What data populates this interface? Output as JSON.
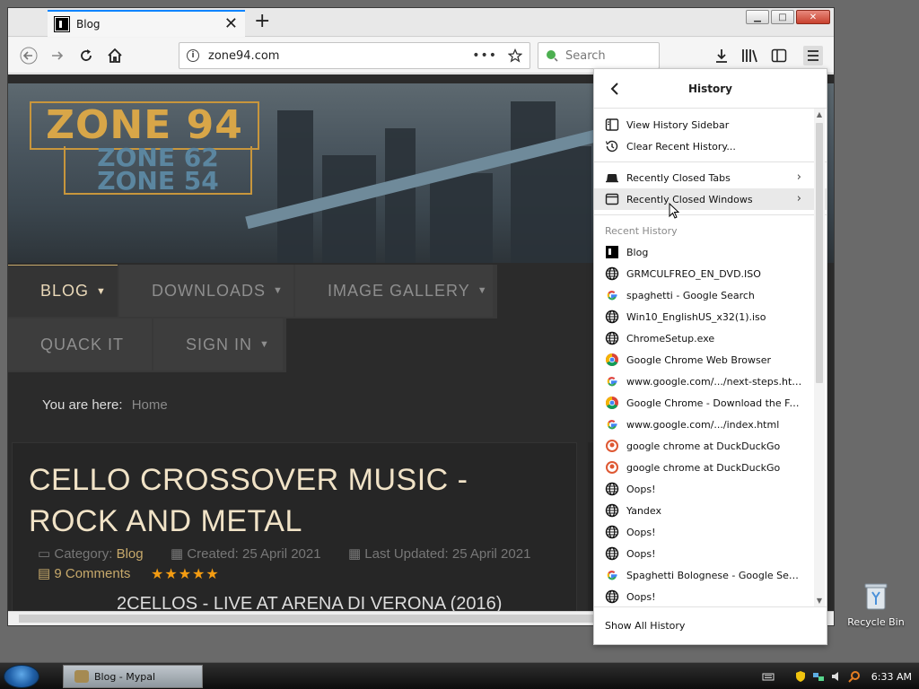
{
  "desktop": {
    "recycle_bin_label": "Recycle Bin"
  },
  "browser": {
    "tab": {
      "title": "Blog",
      "close_glyph": "✕"
    },
    "new_tab_glyph": "+",
    "window_controls": {
      "minimize": "▁",
      "maximize": "□",
      "close": "✕"
    },
    "url": "zone94.com",
    "url_actions_glyph": "•••",
    "search_placeholder": "Search"
  },
  "page": {
    "logo_main": "ZONE 94",
    "logo_sub": "ZONE 62\nZONE 54",
    "menu": [
      {
        "label": "BLOG",
        "caret": "▼"
      },
      {
        "label": "DOWNLOADS",
        "caret": "▼"
      },
      {
        "label": "IMAGE GALLERY",
        "caret": "▼"
      },
      {
        "label": "QUACK IT"
      },
      {
        "label": "SIGN IN",
        "caret": "▼"
      }
    ],
    "breadcrumb": {
      "prefix": "You are here:",
      "current": "Home"
    },
    "article": {
      "title": "CELLO CROSSOVER MUSIC - ROCK AND METAL",
      "category_prefix": "Category:",
      "category": "Blog",
      "created": "Created: 25 April 2021",
      "updated": "Last Updated: 25 April 2021",
      "comments": "9 Comments",
      "stars": "★★★★★",
      "subheading": "2CELLOS - LIVE AT ARENA DI VERONA (2016)"
    }
  },
  "history_panel": {
    "title": "History",
    "actions": [
      {
        "label": "View History Sidebar",
        "icon": "sidebar-icon"
      },
      {
        "label": "Clear Recent History...",
        "icon": "clock-icon"
      }
    ],
    "submenus": [
      {
        "label": "Recently Closed Tabs",
        "icon": "tab-icon"
      },
      {
        "label": "Recently Closed Windows",
        "icon": "window-icon"
      }
    ],
    "recent_history_label": "Recent History",
    "items": [
      {
        "label": "Blog",
        "icon": "zone94-favicon"
      },
      {
        "label": "GRMCULFREO_EN_DVD.ISO",
        "icon": "globe-icon"
      },
      {
        "label": "spaghetti - Google Search",
        "icon": "google-icon"
      },
      {
        "label": "Win10_EnglishUS_x32(1).iso",
        "icon": "globe-icon"
      },
      {
        "label": "ChromeSetup.exe",
        "icon": "globe-icon"
      },
      {
        "label": "Google Chrome Web Browser",
        "icon": "chrome-icon"
      },
      {
        "label": "www.google.com/.../next-steps.html",
        "icon": "google-icon"
      },
      {
        "label": "Google Chrome - Download the Fas...",
        "icon": "chrome-icon"
      },
      {
        "label": "www.google.com/.../index.html",
        "icon": "google-icon"
      },
      {
        "label": "google chrome at DuckDuckGo",
        "icon": "duckduckgo-icon"
      },
      {
        "label": "google chrome at DuckDuckGo",
        "icon": "duckduckgo-icon"
      },
      {
        "label": "Oops!",
        "icon": "globe-icon"
      },
      {
        "label": "Yandex",
        "icon": "globe-icon"
      },
      {
        "label": "Oops!",
        "icon": "globe-icon"
      },
      {
        "label": "Oops!",
        "icon": "globe-icon"
      },
      {
        "label": "Spaghetti Bolognese - Google Search",
        "icon": "google-icon"
      },
      {
        "label": "Oops!",
        "icon": "globe-icon"
      }
    ],
    "footer": "Show All History"
  },
  "taskbar": {
    "app_label": "Blog - Mypal",
    "clock": "6:33 AM"
  }
}
